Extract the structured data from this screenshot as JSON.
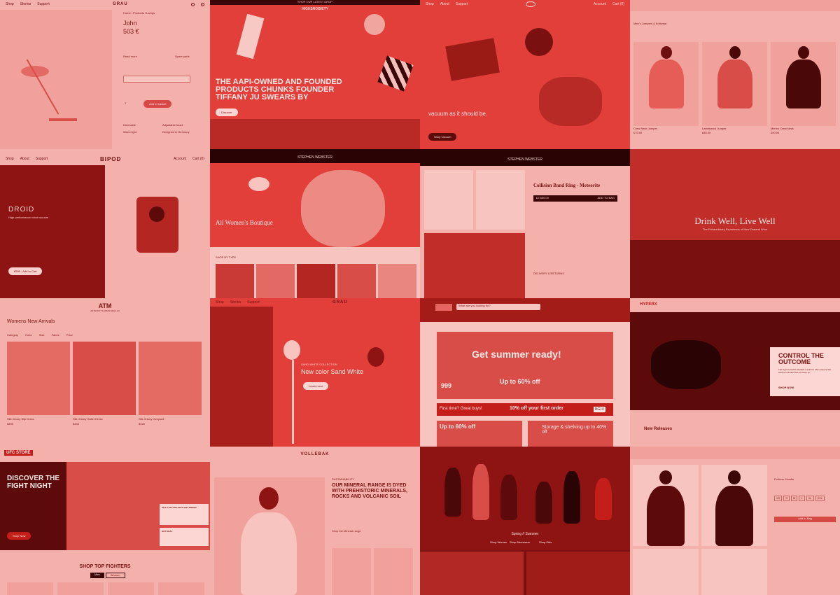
{
  "colors": {
    "tint": "#d63a36",
    "pink": "#f4b0aa",
    "deep": "#8e1414",
    "dark": "#4a0808"
  },
  "t1": {
    "nav": [
      "Shop",
      "Stories",
      "Support"
    ],
    "logo": "GRAU",
    "crumbs": [
      "Home",
      "Products",
      "Lamps"
    ],
    "name": "John",
    "price": "503 €",
    "read_more": "Read more",
    "spare": "Spare parts",
    "qty": "1",
    "add": "Add to basket",
    "feat": [
      "Dimmable",
      "Adjustable head",
      "Warm light",
      "Designed in Germany"
    ]
  },
  "t2": {
    "banner": "SHOP OUR LATEST DROP",
    "logo": "HIGHSNOBIETY",
    "headline": "THE AAPI-OWNED AND FOUNDED PRODUCTS CHUNKS FOUNDER TIFFANY JU SWEARS BY",
    "cta": "Discover"
  },
  "t3": {
    "nav": [
      "Shop",
      "About",
      "Support"
    ],
    "acct": "Account",
    "cart": "Cart (0)",
    "tagline": "vacuum as it should be.",
    "cta": "Shop vacuum"
  },
  "t4": {
    "headline": "Men's Jumpers & Knitwear",
    "labels": [
      "Crew Neck Jumper",
      "Lambswool Jumper",
      "Merino Crew Neck"
    ],
    "prices": [
      "£70.00",
      "£85.00",
      "£90.00"
    ]
  },
  "t5": {
    "nav": [
      "Shop",
      "About",
      "Support"
    ],
    "logo": "BIPOD",
    "acct": "Account",
    "cart": "Cart (0)",
    "title": "DROID",
    "sub": "High performance robot vacuum",
    "cta": "€599 - Add to Cart"
  },
  "t6": {
    "logo": "STEPHEN WEBSTER",
    "headline": "All Women's Boutique",
    "shop": "SHOP BY TYPE"
  },
  "t7": {
    "logo": "STEPHEN WEBSTER",
    "title": "Collision Band Ring - Meteorite",
    "price": "£2,850.00",
    "add": "ADD TO BAG",
    "delivery": "DELIVERY & RETURNS"
  },
  "t8": {
    "headline": "Drink Well, Live Well",
    "sub": "The Extraordinary Experience of New Zealand Wine"
  },
  "t9": {
    "logo": "ATM",
    "sub": "ANTHONY THOMAS MELILLO",
    "headline": "Womens New Arrivals",
    "filters": [
      "Category",
      "Color",
      "Size",
      "Fabric",
      "Price"
    ],
    "items": [
      "Silk Jersey Slip Dress",
      "Silk Jersey Halter Dress",
      "Silk Jersey Jumpsuit"
    ],
    "prices": [
      "$395",
      "$345",
      "$425"
    ]
  },
  "t10": {
    "nav": [
      "Shop",
      "Stories",
      "Support"
    ],
    "logo": "GRAU",
    "kicker": "SAND WHITE COLLECTION",
    "headline": "New color Sand White",
    "cta": "Learn more"
  },
  "t11": {
    "search": "What are you looking for?",
    "headline": "Get summer ready!",
    "deal": "Up to 60% off",
    "price": "999",
    "first": "First time? Great buys!",
    "offer": "10% off your first order",
    "code": "BG10",
    "tiles": [
      "Up to 60% off",
      "Storage & shelving up to 40% off"
    ]
  },
  "t12": {
    "logo": "HYPERX",
    "title": "CONTROL THE OUTCOME",
    "body": "The HyperX Clutch Gladiate is built for Xbox players that want a controller that can keep up.",
    "cta": "SHOP NOW",
    "new": "New Releases"
  },
  "t13": {
    "logo": "UFC STORE",
    "headline": "DISCOVER THE FIGHT NIGHT",
    "cta": "Shop Now",
    "promo": "GET A $10 GIFT WITH ANY ORDER",
    "promo2": "HOT DEAL",
    "section": "SHOP TOP FIGHTERS",
    "tabs": [
      "Men",
      "Women"
    ]
  },
  "t14": {
    "logo": "VOLLEBAK",
    "kicker": "SUSTAINABILITY",
    "headline": "OUR MINERAL RANGE IS DYED WITH PREHISTORIC MINERALS, ROCKS AND VOLCANIC SOIL",
    "cta": "Shop the Mineral range"
  },
  "t15": {
    "headline": "Spring // Summer",
    "labels": [
      "Shop Women",
      "Shop Menswear",
      "Shop Kids"
    ]
  },
  "t16": {
    "title": "Pullover Hoodie",
    "sizes": [
      "XS",
      "S",
      "M",
      "L",
      "XL",
      "XXL"
    ],
    "add": "Add to Bag"
  }
}
